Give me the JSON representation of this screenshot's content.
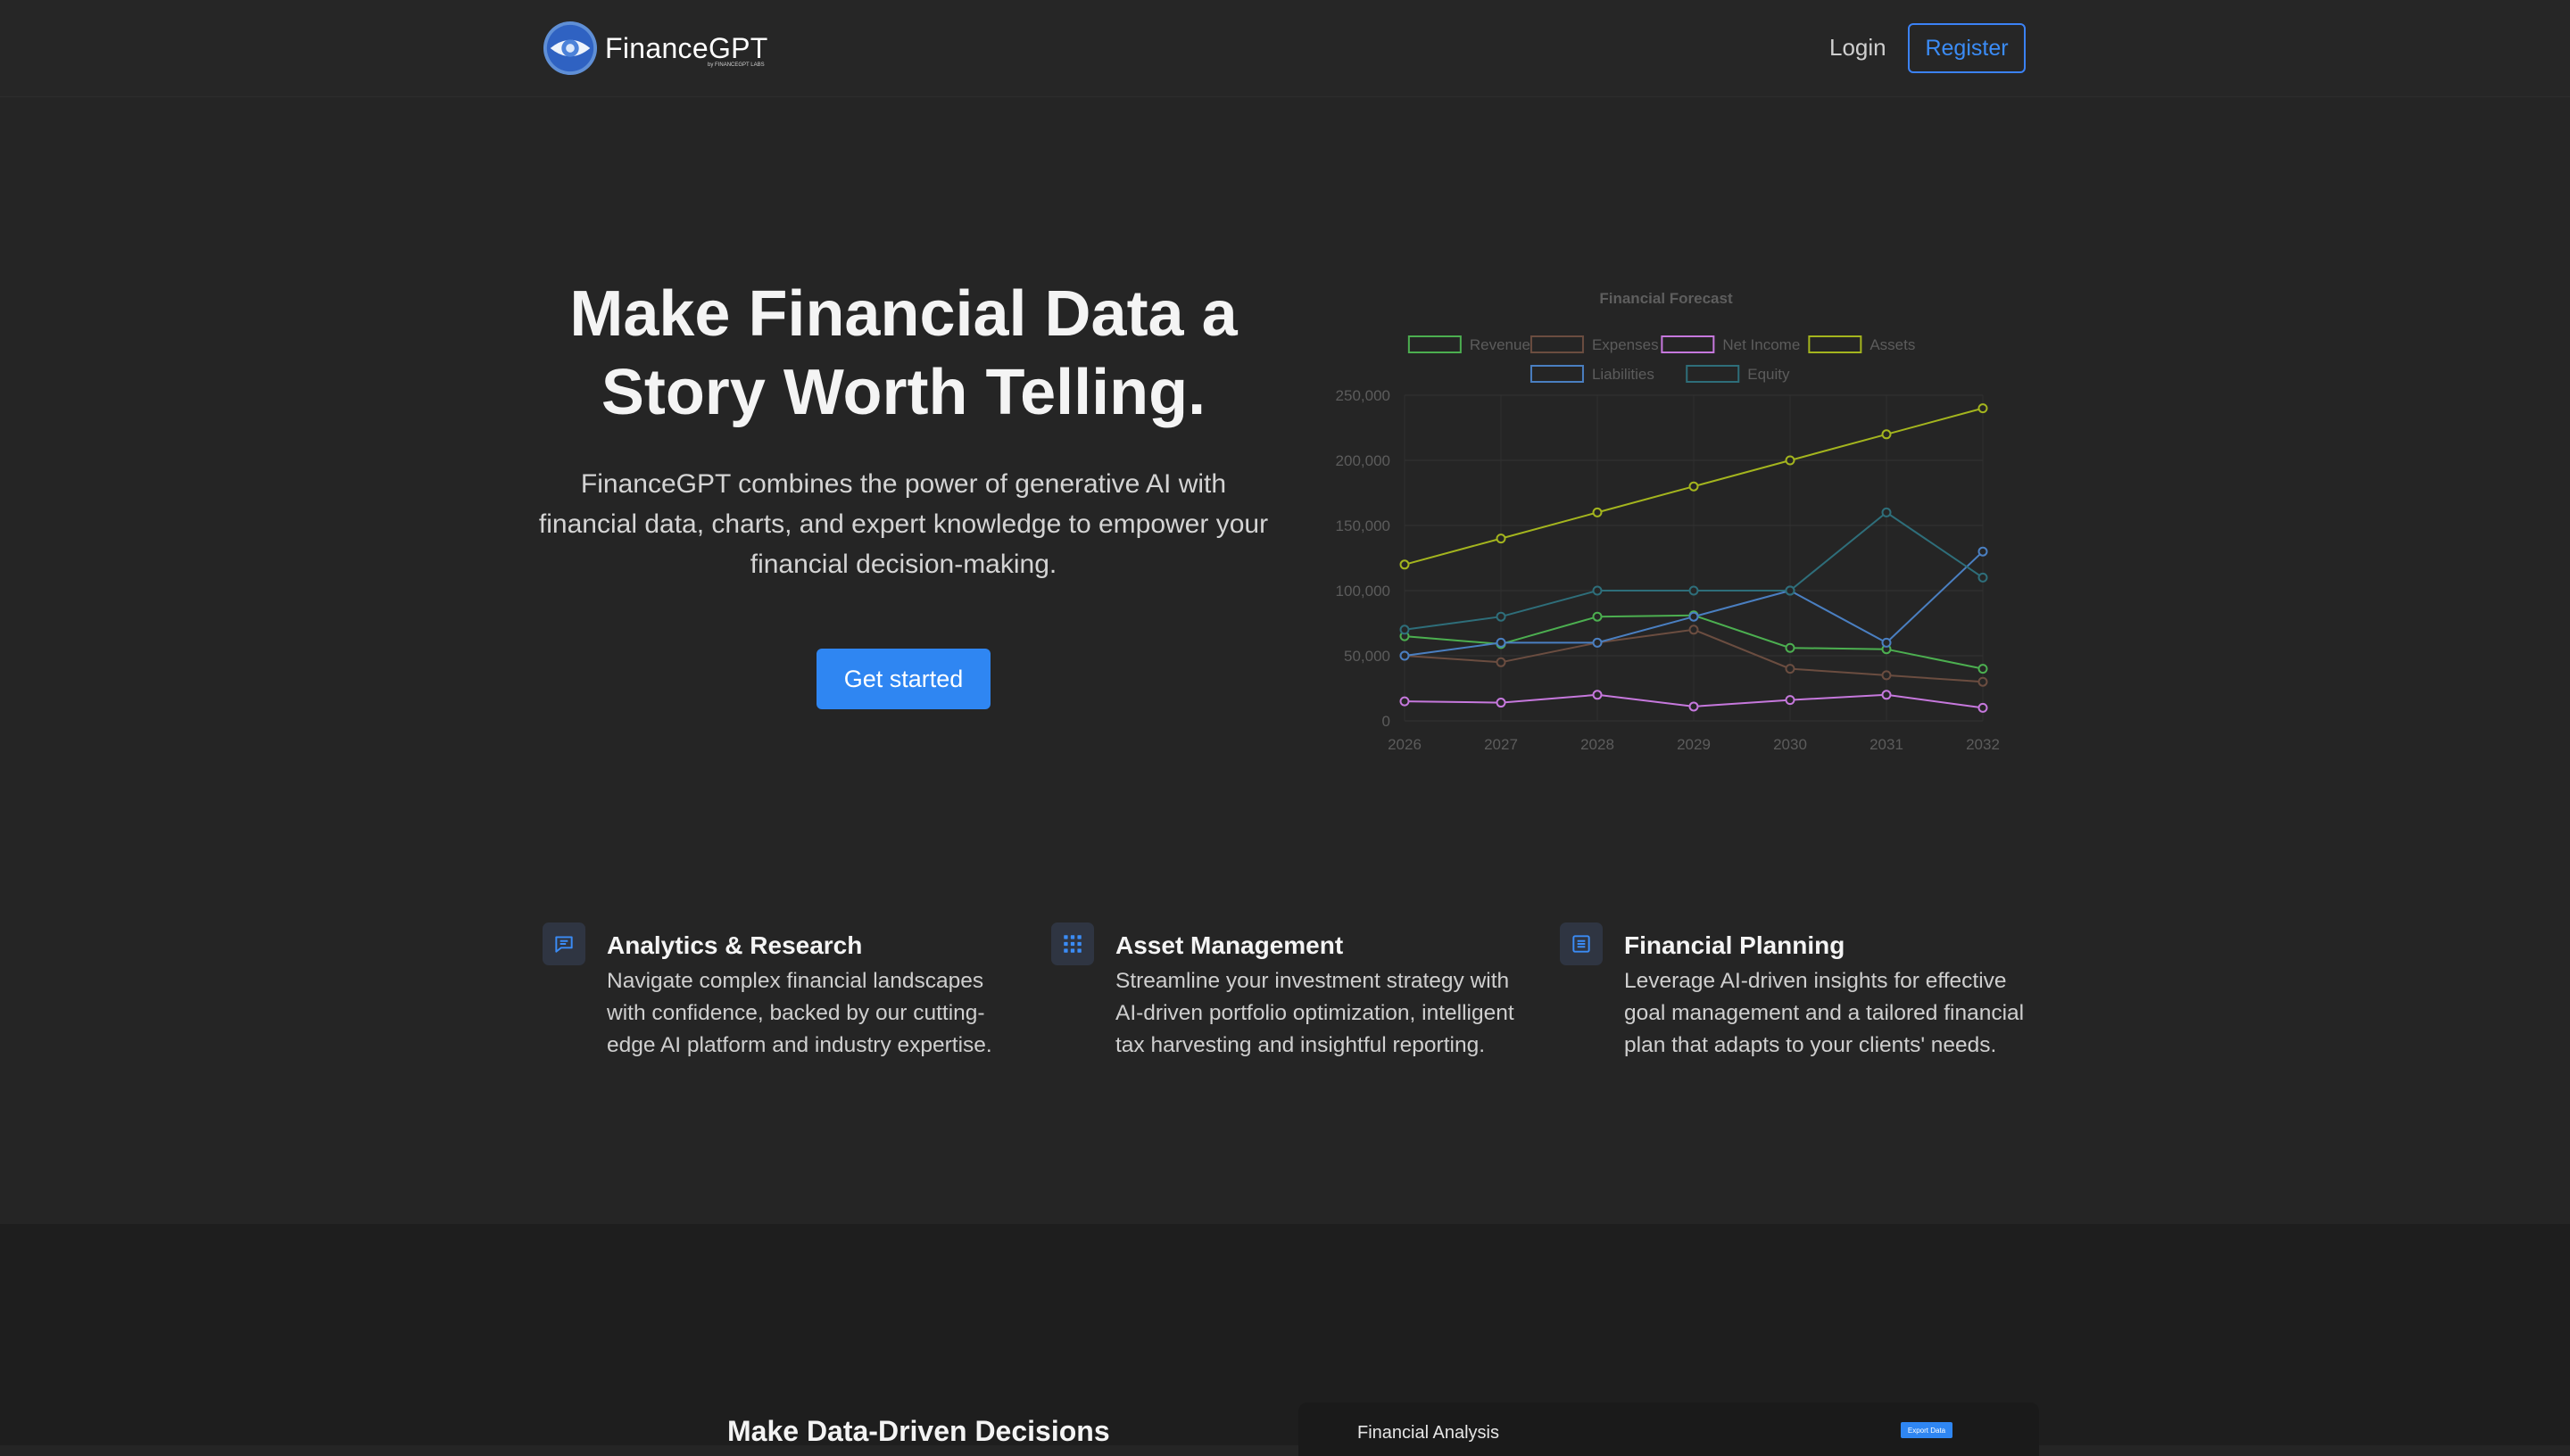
{
  "header": {
    "logo_name": "FinanceGPT",
    "logo_sub": "by FINANCEGPT LABS",
    "login_label": "Login",
    "register_label": "Register"
  },
  "hero": {
    "title": "Make Financial Data a Story Worth Telling.",
    "subtitle": "FinanceGPT combines the power of generative AI with financial data, charts, and expert knowledge to empower your financial decision-making.",
    "cta_label": "Get started"
  },
  "chart_data": {
    "type": "line",
    "title": "Financial Forecast",
    "xlabel": "",
    "ylabel": "",
    "x": [
      "2026",
      "2027",
      "2028",
      "2029",
      "2030",
      "2031",
      "2032"
    ],
    "ylim": [
      0,
      250000
    ],
    "yticks": [
      "0",
      "50,000",
      "100,000",
      "150,000",
      "200,000",
      "250,000"
    ],
    "grid": true,
    "legend": "top",
    "series": [
      {
        "name": "Revenue",
        "color": "#4caf50",
        "values": [
          65000,
          59000,
          80000,
          81000,
          56000,
          55000,
          40000
        ]
      },
      {
        "name": "Expenses",
        "color": "#6b4d40",
        "values": [
          50000,
          45000,
          60000,
          70000,
          40000,
          35000,
          30000
        ]
      },
      {
        "name": "Net Income",
        "color": "#c678dd",
        "values": [
          15000,
          14000,
          20000,
          11000,
          16000,
          20000,
          10000
        ]
      },
      {
        "name": "Assets",
        "color": "#a4b51e",
        "values": [
          120000,
          140000,
          160000,
          180000,
          200000,
          220000,
          240000
        ]
      },
      {
        "name": "Liabilities",
        "color": "#4a7fc1",
        "values": [
          50000,
          60000,
          60000,
          80000,
          100000,
          60000,
          130000
        ]
      },
      {
        "name": "Equity",
        "color": "#2e6e7a",
        "values": [
          70000,
          80000,
          100000,
          100000,
          100000,
          160000,
          110000
        ]
      }
    ]
  },
  "features": [
    {
      "icon": "chat-icon",
      "title": "Analytics & Research",
      "desc": "Navigate complex financial landscapes with confidence, backed by our cutting-edge AI platform and industry expertise."
    },
    {
      "icon": "grid-icon",
      "title": "Asset Management",
      "desc": "Streamline your investment strategy with AI-driven portfolio optimization, intelligent tax harvesting and insightful reporting."
    },
    {
      "icon": "document-icon",
      "title": "Financial Planning",
      "desc": "Leverage AI-driven insights for effective goal management and a tailored financial plan that adapts to your clients' needs."
    }
  ],
  "lower": {
    "title": "Make Data-Driven Decisions",
    "analysis_title": "Financial Analysis",
    "export_label": "Export Data"
  },
  "colors": {
    "background": "#252525",
    "accent": "#2f86f2",
    "lower_background": "#1e1e1e"
  }
}
